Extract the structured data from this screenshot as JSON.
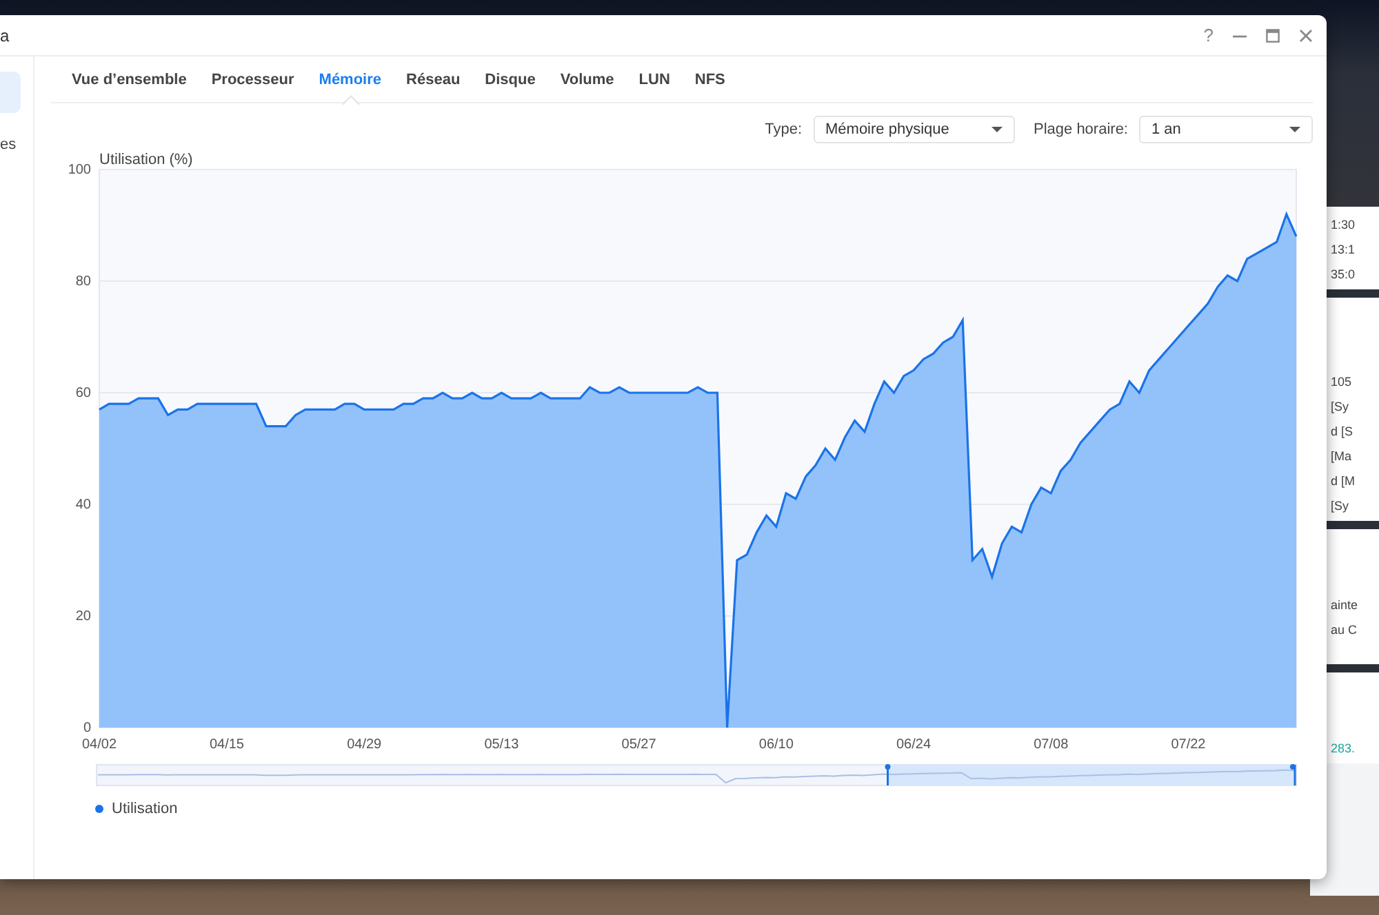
{
  "background_window": {
    "panels": [
      {
        "lines": [
          "1:30",
          "13:1",
          "35:0"
        ]
      },
      {
        "lines": [
          "105",
          "[Sy",
          "d [S",
          "[Ma",
          "d [M",
          "[Sy"
        ]
      },
      {
        "lines": [
          "ainte",
          "au C"
        ]
      },
      {
        "lines": [
          "283."
        ]
      }
    ]
  },
  "window": {
    "title": "a",
    "help": "?"
  },
  "sidebar": {
    "items": [
      {
        "selected": true
      },
      {
        "label": "es",
        "selected": false
      }
    ]
  },
  "tabs": [
    {
      "label": "Vue d’ensemble",
      "selected": false
    },
    {
      "label": "Processeur",
      "selected": false
    },
    {
      "label": "Mémoire",
      "selected": true
    },
    {
      "label": "Réseau",
      "selected": false
    },
    {
      "label": "Disque",
      "selected": false
    },
    {
      "label": "Volume",
      "selected": false
    },
    {
      "label": "LUN",
      "selected": false
    },
    {
      "label": "NFS",
      "selected": false
    }
  ],
  "filters": [
    {
      "label": "Type:",
      "value": "Mémoire physique"
    },
    {
      "label": "Plage horaire:",
      "value": "1 an"
    }
  ],
  "chart": {
    "chart_data": {
      "type": "area",
      "ylabel": "Utilisation (%)",
      "ylim": [
        0,
        100
      ],
      "grid": true,
      "yticks": [
        0,
        20,
        40,
        60,
        80,
        100
      ],
      "categories": [
        "04/02",
        null,
        null,
        null,
        null,
        null,
        null,
        null,
        null,
        null,
        null,
        null,
        null,
        "04/15",
        null,
        null,
        null,
        null,
        null,
        null,
        null,
        null,
        null,
        null,
        null,
        null,
        null,
        "04/29",
        null,
        null,
        null,
        null,
        null,
        null,
        null,
        null,
        null,
        null,
        null,
        null,
        null,
        "05/13",
        null,
        null,
        null,
        null,
        null,
        null,
        null,
        null,
        null,
        null,
        null,
        null,
        null,
        "05/27",
        null,
        null,
        null,
        null,
        null,
        null,
        null,
        null,
        null,
        null,
        null,
        null,
        null,
        "06/10",
        null,
        null,
        null,
        null,
        null,
        null,
        null,
        null,
        null,
        null,
        null,
        null,
        null,
        "06/24",
        null,
        null,
        null,
        null,
        null,
        null,
        null,
        null,
        null,
        null,
        null,
        null,
        null,
        "07/08",
        null,
        null,
        null,
        null,
        null,
        null,
        null,
        null,
        null,
        null,
        null,
        null,
        null,
        "07/22",
        null,
        null,
        null,
        null,
        null,
        null,
        null,
        null,
        null,
        null,
        null
      ],
      "series": [
        {
          "name": "Utilisation",
          "color": "#1a73e8",
          "values": [
            57,
            58,
            58,
            58,
            59,
            59,
            59,
            56,
            57,
            57,
            58,
            58,
            58,
            58,
            58,
            58,
            58,
            54,
            54,
            54,
            56,
            57,
            57,
            57,
            57,
            58,
            58,
            57,
            57,
            57,
            57,
            58,
            58,
            59,
            59,
            60,
            59,
            59,
            60,
            59,
            59,
            60,
            59,
            59,
            59,
            60,
            59,
            59,
            59,
            59,
            61,
            60,
            60,
            61,
            60,
            60,
            60,
            60,
            60,
            60,
            60,
            61,
            60,
            60,
            0,
            30,
            31,
            35,
            38,
            36,
            42,
            41,
            45,
            47,
            50,
            48,
            52,
            55,
            53,
            58,
            62,
            60,
            63,
            64,
            66,
            67,
            69,
            70,
            73,
            30,
            32,
            27,
            33,
            36,
            35,
            40,
            43,
            42,
            46,
            48,
            51,
            53,
            55,
            57,
            58,
            62,
            60,
            64,
            66,
            68,
            70,
            72,
            74,
            76,
            79,
            81,
            80,
            84,
            85,
            86,
            87,
            92,
            88
          ]
        }
      ]
    }
  }
}
